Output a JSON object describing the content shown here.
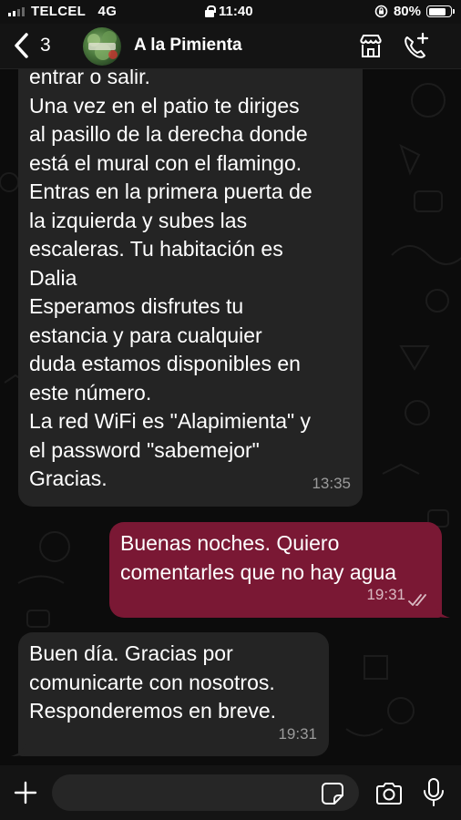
{
  "status_bar": {
    "carrier": "TELCEL",
    "network": "4G",
    "time": "11:40",
    "battery_text": "80%",
    "battery_level": 0.8
  },
  "header": {
    "back_count": "3",
    "contact_name": "A la Pimienta"
  },
  "messages": [
    {
      "direction": "incoming",
      "lines": [
        "entrar o salir.",
        "Una vez en el patio te diriges",
        "al pasillo de la derecha donde",
        "está el mural con el flamingo.",
        "Entras en la primera puerta de",
        "la izquierda y subes las",
        "escaleras. Tu habitación es",
        "Dalia",
        "Esperamos disfrutes tu",
        "estancia y para cualquier",
        "duda estamos disponibles en",
        "este número.",
        "La red WiFi es \"Alapimienta\" y",
        "el password \"sabemejor\"",
        "Gracias."
      ],
      "time": "13:35"
    },
    {
      "direction": "outgoing",
      "lines": [
        "Buenas noches. Quiero",
        "comentarles que no hay agua"
      ],
      "time": "19:31",
      "status": "read"
    },
    {
      "direction": "incoming",
      "lines": [
        "Buen día. Gracias por",
        "comunicarte con nosotros.",
        "Responderemos en breve."
      ],
      "time": "19:31"
    }
  ],
  "composer": {
    "value": "",
    "placeholder": ""
  },
  "icons": {
    "back": "chevron-left-icon",
    "catalog": "store-icon",
    "call": "phone-plus-icon",
    "attach": "plus-icon",
    "sticker": "sticker-icon",
    "camera": "camera-icon",
    "mic": "microphone-icon",
    "read": "double-check-icon"
  },
  "colors": {
    "outgoing_bubble": "#7a1834",
    "incoming_bubble": "#242424",
    "background": "#0c0c0c"
  }
}
